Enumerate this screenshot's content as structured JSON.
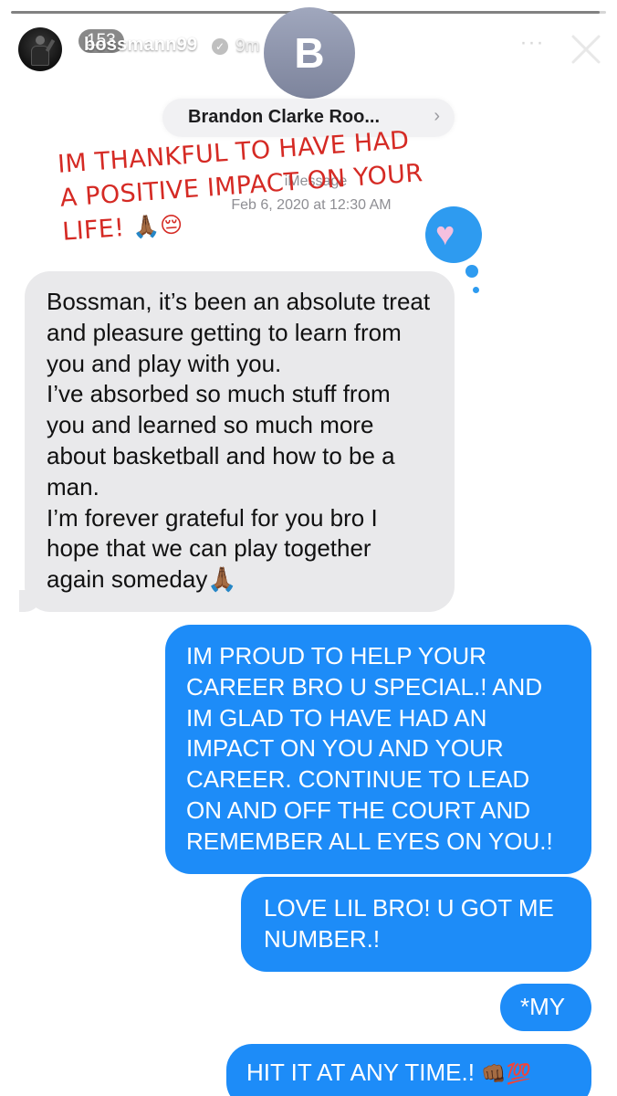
{
  "story": {
    "progress": 0.99,
    "viewer_count": "153",
    "username": "bossmann99",
    "verified": true,
    "time_ago": "9m",
    "more_label": "···",
    "colors": {
      "sent_bubble": "#1d8cf8",
      "received_bubble": "#e9e9eb",
      "caption": "#d52a24"
    },
    "icons": [
      "verified-icon",
      "more-icon",
      "close-icon"
    ]
  },
  "contact": {
    "initial": "B",
    "name": "Brandon Clarke Roo...",
    "chevron": "›"
  },
  "thread": {
    "service_label": "iMessage",
    "date_label": "Feb 6, 2020 at 12:30 AM"
  },
  "caption": {
    "text": "IM THANKFUL TO HAVE HAD A POSITIVE IMPACT ON YOUR LIFE!",
    "emoji": "🙏🏾😔"
  },
  "tapback": {
    "icon": "heart-icon",
    "glyph": "♥"
  },
  "messages": [
    {
      "direction": "received",
      "text": "Bossman, it’s been an absolute treat and pleasure getting to learn from you and play with you.\nI’ve absorbed so much stuff from you and learned so much more about basketball and how to be a man.\nI’m forever grateful for you bro I hope that we can play together again someday🙏🏾"
    },
    {
      "direction": "sent",
      "text": "IM PROUD TO HELP YOUR CAREER BRO U SPECIAL.! AND IM GLAD TO HAVE HAD AN IMPACT ON YOU AND YOUR CAREER. CONTINUE TO LEAD ON AND OFF THE COURT AND REMEMBER ALL EYES ON YOU.!"
    },
    {
      "direction": "sent",
      "text": "LOVE LIL BRO! U GOT ME NUMBER.!"
    },
    {
      "direction": "sent",
      "text": "*MY"
    },
    {
      "direction": "sent",
      "text": "HIT IT AT ANY TIME.!",
      "emoji": "👊🏾💯"
    }
  ]
}
